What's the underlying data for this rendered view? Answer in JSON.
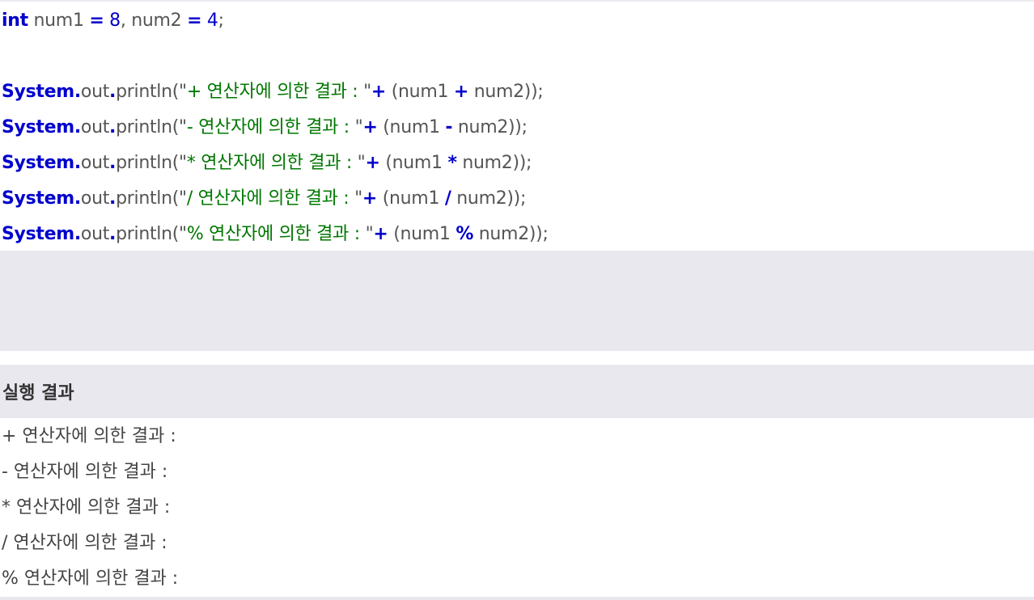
{
  "code": {
    "decl": {
      "kw": "int",
      "a": " num1 ",
      "eq1": "=",
      "v1": " 8",
      "comma": ", num2 ",
      "eq2": "=",
      "v2": " 4",
      "semi": ";"
    },
    "lines": [
      {
        "sys": "System",
        "dot1": ".",
        "out": "out",
        "dot2": ".",
        "call": "println(\"",
        "str": "+ 연산자에 의한 결과 : ",
        "close": "\"",
        "plus": "+",
        "open": " (num1 ",
        "op": "+",
        "rest": " num2));"
      },
      {
        "sys": "System",
        "dot1": ".",
        "out": "out",
        "dot2": ".",
        "call": "println(\"",
        "str": "- 연산자에 의한 결과 : ",
        "close": "\"",
        "plus": "+",
        "open": " (num1 ",
        "op": "-",
        "rest": " num2));"
      },
      {
        "sys": "System",
        "dot1": ".",
        "out": "out",
        "dot2": ".",
        "call": "println(\"",
        "str": "* 연산자에 의한 결과 : ",
        "close": "\"",
        "plus": "+",
        "open": " (num1 ",
        "op": "*",
        "rest": " num2));"
      },
      {
        "sys": "System",
        "dot1": ".",
        "out": "out",
        "dot2": ".",
        "call": "println(\"",
        "str": "/ 연산자에 의한 결과 : ",
        "close": "\"",
        "plus": "+",
        "open": " (num1 ",
        "op": "/",
        "rest": " num2));"
      },
      {
        "sys": "System",
        "dot1": ".",
        "out": "out",
        "dot2": ".",
        "call": "println(\"",
        "str": "% 연산자에 의한 결과 : ",
        "close": "\"",
        "plus": "+",
        "open": " (num1 ",
        "op": "%",
        "rest": " num2));"
      }
    ]
  },
  "result": {
    "title": "실행 결과",
    "lines": [
      "+ 연산자에 의한 결과 :",
      "- 연산자에 의한 결과 :",
      "* 연산자에 의한 결과 :",
      "/ 연산자에 의한 결과 :",
      "% 연산자에 의한 결과 :"
    ]
  }
}
